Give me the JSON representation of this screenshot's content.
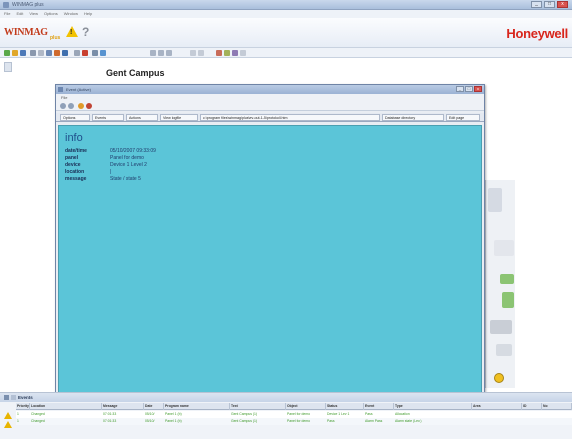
{
  "window": {
    "title": "WINMAG plus",
    "menu": [
      "File",
      "Edit",
      "View",
      "Options",
      "Window",
      "Help"
    ],
    "min_glyph": "_",
    "max_glyph": "□",
    "close_glyph": "x"
  },
  "logo": {
    "winmag": "WINMAG",
    "plus": "plus",
    "honeywell": "Honeywell",
    "warn_glyph": "!",
    "help_glyph": "?"
  },
  "toolbar": {
    "icons": [
      "new-icon",
      "open-icon",
      "save-icon",
      "print-icon",
      "cut-icon",
      "copy-icon",
      "paste-icon",
      "delete-icon",
      "zoom-icon",
      "refresh-icon",
      "settings-icon",
      "layers-icon"
    ]
  },
  "main": {
    "title": "Gent Campus"
  },
  "event_window": {
    "title": "Event (Active)",
    "menu": "File",
    "tabs": [
      "Options",
      "Events",
      "Actions",
      "View logfile",
      "c:\\program files\\winmag\\plus\\ev-out-1-5\\protokoll.htm",
      "Database directory",
      "Edit page"
    ],
    "info": {
      "heading": "info",
      "rows": [
        {
          "key": "date/time",
          "value": "05/10/2007 09:33:09"
        },
        {
          "key": "panel",
          "value": "Panel for demo"
        },
        {
          "key": "device",
          "value": "Device 1 Level 2"
        },
        {
          "key": "location",
          "value": "|"
        },
        {
          "key": "message",
          "value": "State / state 5"
        }
      ]
    }
  },
  "events_panel": {
    "title": "Events",
    "columns": [
      "Priority",
      "Location",
      "Message",
      "Date",
      "Program name",
      "Text",
      "Object",
      "Status",
      "Event",
      "Type",
      "Area",
      "ID",
      "No"
    ],
    "rows": [
      [
        "1",
        "Changed",
        "07:01:33",
        "05/10/",
        "Panel 1 (b)",
        "Gent Campus (1)",
        "Panel for demo",
        "Device 1 Lev 1",
        "Pass",
        "Allocation",
        "",
        "",
        ""
      ],
      [
        "1",
        "Changed",
        "07:01:33",
        "05/10/",
        "Panel 1 (b)",
        "Gent Campus (1)",
        "Panel for demo",
        "Pass",
        "Alarm Pass",
        "Alarm state (Lev.)",
        "",
        "",
        ""
      ]
    ]
  },
  "colors": {
    "info_bg": "#5bc5d8",
    "brand_red": "#d8261c",
    "event_green": "#3f9a2a"
  }
}
